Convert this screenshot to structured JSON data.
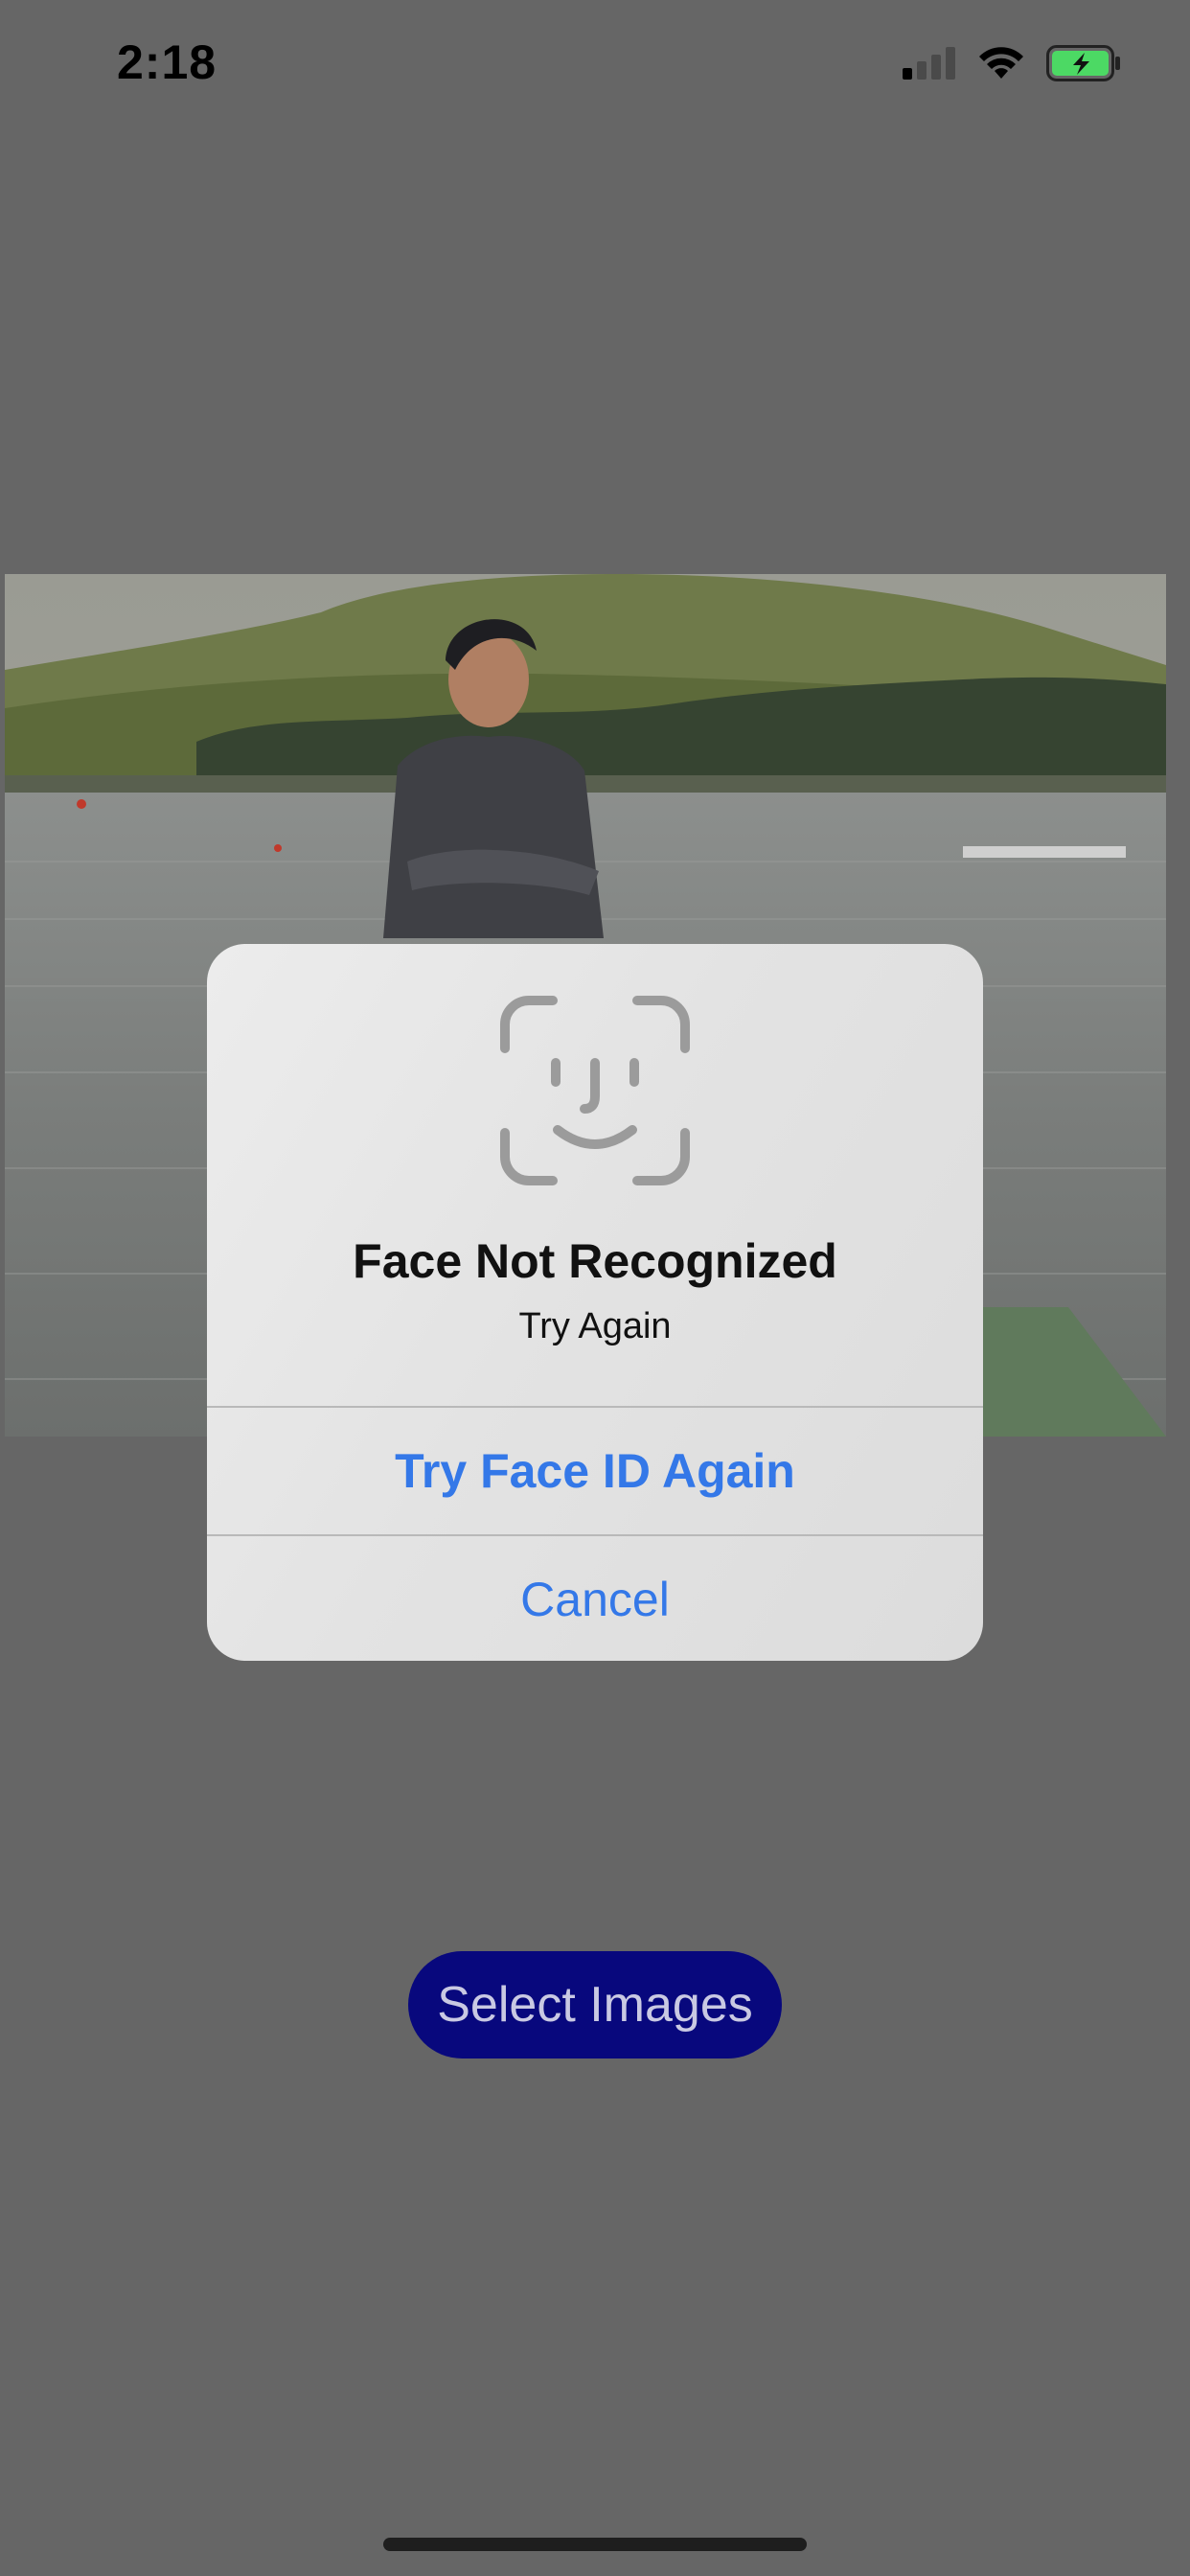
{
  "status_bar": {
    "time": "2:18",
    "signal_icon": "cellular-signal-icon",
    "wifi_icon": "wifi-icon",
    "battery_icon": "battery-charging-icon"
  },
  "photo": {
    "description_icon": "photo"
  },
  "alert": {
    "icon": "face-id-icon",
    "title": "Face Not Recognized",
    "message": "Try Again",
    "primary_action": "Try Face ID Again",
    "cancel_action": "Cancel",
    "accent_color": "#3478e8"
  },
  "select_images_label": "Select Images",
  "colors": {
    "background": "#666666",
    "button": "#08087d",
    "battery": "#4cd964"
  }
}
